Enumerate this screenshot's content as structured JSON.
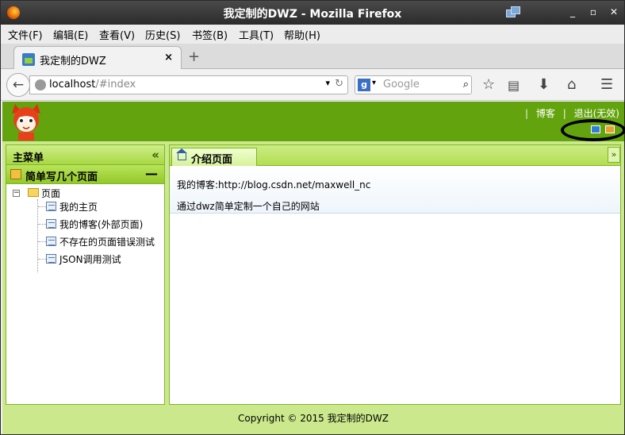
{
  "window": {
    "title": "我定制的DWZ - Mozilla Firefox"
  },
  "menubar": [
    "文件(F)",
    "编辑(E)",
    "查看(V)",
    "历史(S)",
    "书签(B)",
    "工具(T)",
    "帮助(H)"
  ],
  "tab": {
    "title": "我定制的DWZ",
    "close": "×",
    "new_tab": "+"
  },
  "navbar": {
    "url_host": "localhost",
    "url_path": "/#index",
    "search_placeholder": "Google",
    "search_engine": "g"
  },
  "header": {
    "links": [
      "博客",
      "退出(无效)"
    ],
    "separator": "|",
    "theme_colors": [
      "#2f7fd6",
      "#e8a030"
    ],
    "annotation": "black oval highlighting theme switcher"
  },
  "sidebar": {
    "title": "主菜单",
    "collapse": "«",
    "accordion": {
      "title": "简单写几个页面",
      "toggle": "—"
    },
    "tree": {
      "root": "页面",
      "items": [
        "我的主页",
        "我的博客(外部页面)",
        "不存在的页面错误测试",
        "JSON调用测试"
      ]
    }
  },
  "main": {
    "tab": "介绍页面",
    "lines": [
      "我的博客:http://blog.csdn.net/maxwell_nc",
      "通过dwz简单定制一个自己的网站"
    ]
  },
  "footer": {
    "text": "Copyright © 2015 我定制的DWZ"
  }
}
